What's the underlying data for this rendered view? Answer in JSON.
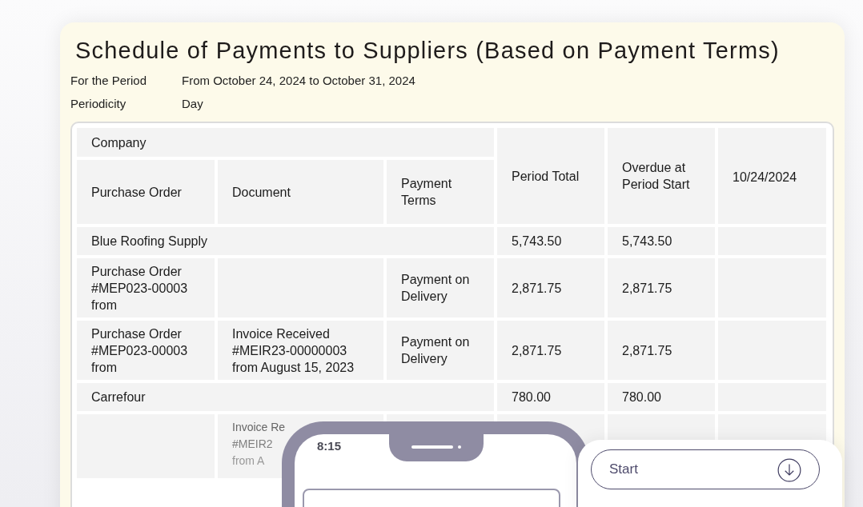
{
  "title": "Schedule of Payments to Suppliers (Based on Payment Terms)",
  "meta": [
    {
      "label": "For the Period",
      "value": "From October 24, 2024 to October 31, 2024"
    },
    {
      "label": "Periodicity",
      "value": "Day"
    }
  ],
  "table": {
    "group_header": "Company",
    "columns": [
      "Purchase Order",
      "Document",
      "Payment Terms",
      "Period Total",
      "Overdue at Period Start",
      "10/24/2024"
    ],
    "rows": [
      {
        "kind": "group",
        "name": "Blue Roofing Supply",
        "period_total": "5,743.50",
        "overdue": "5,743.50"
      },
      {
        "kind": "detail",
        "purchase_order": "Purchase Order #MEP023-00003 from",
        "payment_terms": "Payment on Delivery",
        "period_total": "2,871.75",
        "overdue": "2,871.75"
      },
      {
        "kind": "detail",
        "purchase_order": "Purchase Order #MEP023-00003 from",
        "document": "Invoice Received #MEIR23-00000003 from August 15, 2023",
        "payment_terms": "Payment on Delivery",
        "period_total": "2,871.75",
        "overdue": "2,871.75"
      },
      {
        "kind": "group",
        "name": "Carrefour",
        "period_total": "780.00",
        "overdue": "780.00"
      },
      {
        "kind": "partial",
        "document_lines": [
          "Invoice Re",
          "#MEIR2",
          "from A"
        ]
      }
    ]
  },
  "phone": {
    "time": "8:15"
  },
  "start_card": {
    "label": "Start"
  }
}
